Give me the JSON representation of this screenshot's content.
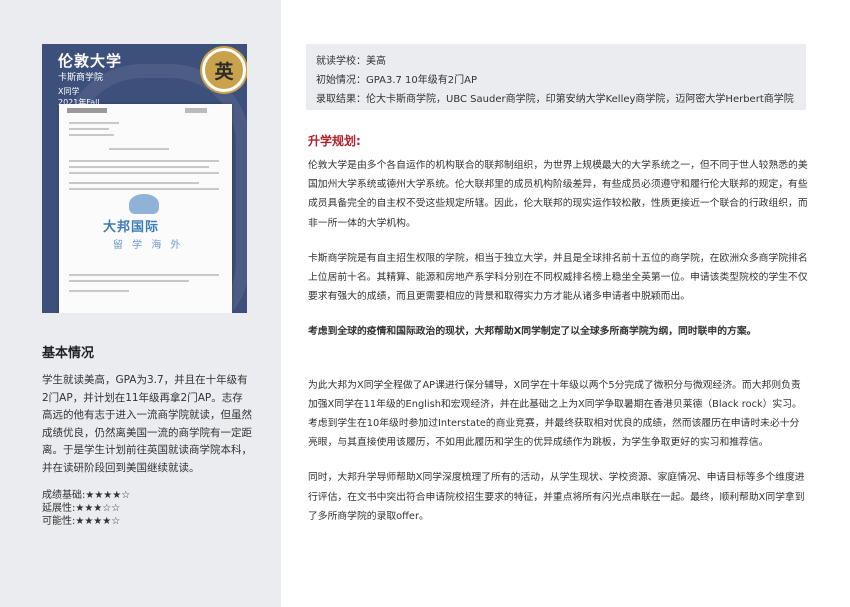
{
  "card": {
    "title": "伦敦大学",
    "school": "卡斯商学院",
    "student": "X同学",
    "term": "2021年Fall",
    "badge": "英",
    "watermark_logo": "大邦国际",
    "watermark_sub": "留  学  海  外"
  },
  "basic": {
    "title": "基本情况",
    "text": "学生就读美高，GPA为3.7，并且在十年级有2门AP，并计划在11年级再拿2门AP。志存高远的他有志于进入一流商学院就读，但虽然成绩优良，仍然离美国一流的商学院有一定距离。于是学生计划前往英国就读商学院本科，并在读研阶段回到美国继续就读。",
    "ratings": [
      {
        "label": "成绩基础:",
        "stars": "★★★★☆"
      },
      {
        "label": "延展性:",
        "stars": "★★★☆☆"
      },
      {
        "label": "可能性:",
        "stars": "★★★★☆"
      }
    ]
  },
  "info": {
    "school": "就读学校：美高",
    "initial": "初始情况：GPA3.7 10年级有2门AP",
    "results": "录取结果：伦大卡斯商学院，UBC Sauder商学院，印第安纳大学Kelley商学院，迈阿密大学Herbert商学院"
  },
  "plan": {
    "title": "升学规划:",
    "p1": "伦敦大学是由多个各自运作的机构联合的联邦制组织，为世界上规模最大的大学系统之一，但不同于世人较熟悉的美国加州大学系统或德州大学系统。伦大联邦里的成员机构阶级差异，有些成员必须遵守和履行伦大联邦的规定，有些成员具备完全的自主权不受这些规定所辖。因此，伦大联邦的现实运作较松散，性质更接近一个联合的行政组织，而非一所一体的大学机构。",
    "p2": "卡斯商学院是有自主招生权限的学院，相当于独立大学，并且是全球排名前十五位的商学院，在欧洲众多商学院排名上位居前十名。其精算、能源和房地产系学科分别在不同权威排名榜上稳坐全英第一位。申请该类型院校的学生不仅要求有强大的成绩，而且更需要相应的背景和取得实力方才能从诸多申请者中脱颖而出。",
    "p3": "考虑到全球的疫情和国际政治的现状，大邦帮助X同学制定了以全球多所商学院为纲，同时联申的方案。",
    "p4": "为此大邦为X同学全程做了AP课进行保分辅导，X同学在十年级以两个5分完成了微积分与微观经济。而大邦则负责加强X同学在11年级的English和宏观经济，并在此基础之上为X同学争取暑期在香港贝莱德（Black rock）实习。考虑到学生在10年级时参加过Interstate的商业竞赛，并最终获取相对优良的成绩，然而该履历在申请时未必十分亮眼，与其直接使用该履历，不如用此履历和学生的优异成绩作为跳板，为学生争取更好的实习和推荐信。",
    "p5": "同时，大邦升学导师帮助X同学深度梳理了所有的活动，从学生现状、学校资源、家庭情况、申请目标等多个维度进行评估，在文书中突出符合申请院校招生要求的特征，并重点将所有闪光点串联在一起。最终，顺利帮助X同学拿到了多所商学院的录取offer。"
  },
  "colors": {
    "card_bg": "#3d4f7b",
    "accent_red": "#b0202c",
    "badge_gold": "#c9a24c",
    "panel_gray": "#eaecef"
  }
}
